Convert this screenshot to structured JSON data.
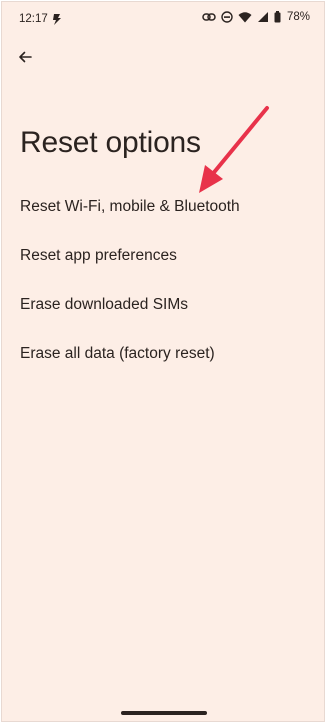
{
  "status_bar": {
    "time": "12:17",
    "battery_percent": "78%",
    "icons": [
      "hotspot-icon",
      "link-icon",
      "dnd-icon",
      "wifi-icon",
      "signal-icon",
      "battery-icon"
    ]
  },
  "header": {
    "back_icon": "arrow-left-icon"
  },
  "page": {
    "title": "Reset options",
    "options": [
      {
        "label": "Reset Wi-Fi, mobile & Bluetooth"
      },
      {
        "label": "Reset app preferences"
      },
      {
        "label": "Erase downloaded SIMs"
      },
      {
        "label": "Erase all data (factory reset)"
      }
    ]
  },
  "annotation": {
    "arrow_color": "#e8324a",
    "points_to": "Reset Wi-Fi, mobile & Bluetooth"
  },
  "colors": {
    "background": "#fdeee6",
    "text": "#2b2320"
  }
}
